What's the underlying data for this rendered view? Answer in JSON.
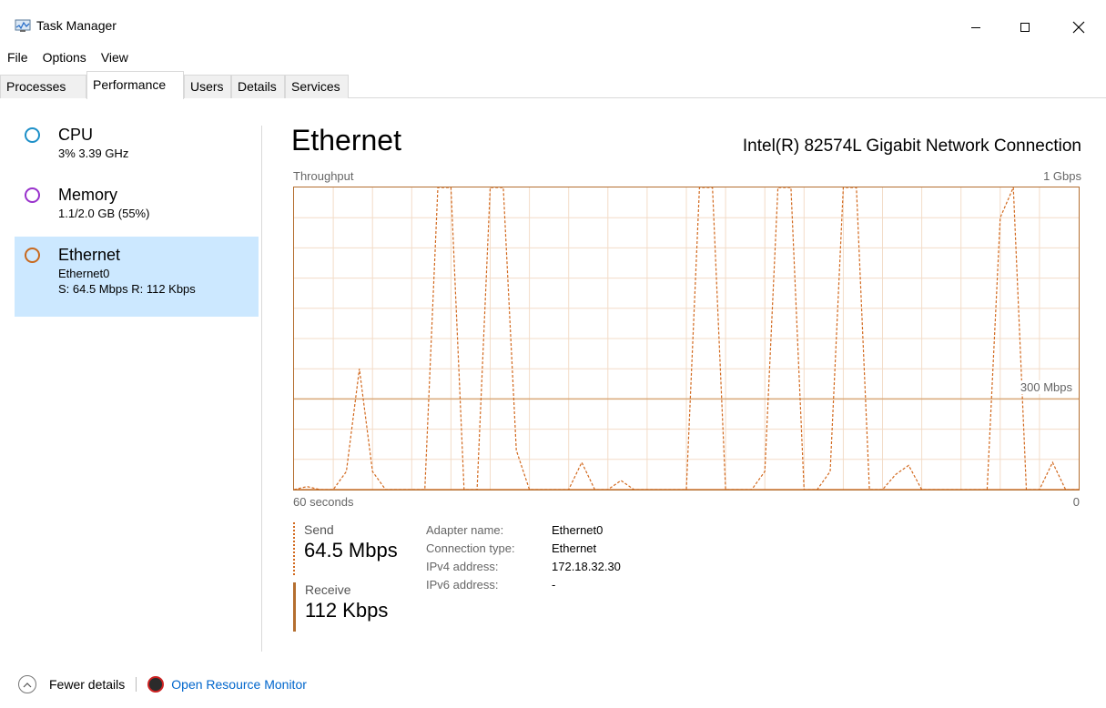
{
  "window": {
    "title": "Task Manager",
    "minimize_icon": "minimize-icon",
    "maximize_icon": "maximize-icon",
    "close_icon": "close-icon"
  },
  "menu": [
    "File",
    "Options",
    "View"
  ],
  "tabs": [
    "Processes",
    "Performance",
    "Users",
    "Details",
    "Services"
  ],
  "active_tab": "Performance",
  "sidebar": {
    "items": [
      {
        "title": "CPU",
        "line1": "3% 3.39 GHz",
        "line2": "",
        "color": "#1e90c8"
      },
      {
        "title": "Memory",
        "line1": "1.1/2.0 GB (55%)",
        "line2": "",
        "color": "#9932cc"
      },
      {
        "title": "Ethernet",
        "line1": "Ethernet0",
        "line2": "S: 64.5 Mbps R: 112 Kbps",
        "color": "#c8691e"
      }
    ],
    "selected": "Ethernet"
  },
  "main": {
    "title": "Ethernet",
    "adapter_full_name": "Intel(R) 82574L Gigabit Network Connection",
    "throughput_label": "Throughput",
    "max_label": "1 Gbps",
    "mid_label": "300 Mbps",
    "time_left": "60 seconds",
    "time_right": "0"
  },
  "stats": {
    "send_label": "Send",
    "send_value": "64.5 Mbps",
    "receive_label": "Receive",
    "receive_value": "112 Kbps"
  },
  "info": [
    {
      "label": "Adapter name:",
      "value": "Ethernet0"
    },
    {
      "label": "Connection type:",
      "value": "Ethernet"
    },
    {
      "label": "IPv4 address:",
      "value": "172.18.32.30"
    },
    {
      "label": "IPv6 address:",
      "value": "-"
    }
  ],
  "footer": {
    "fewer_details": "Fewer details",
    "open_monitor": "Open Resource Monitor"
  },
  "colors": {
    "graph_line": "#d2691e",
    "graph_border": "#b46e2f",
    "grid": "#f3dcc8",
    "accent_link": "#0066cc",
    "selected_bg": "#cce8ff"
  },
  "chart_data": {
    "type": "line",
    "title": "",
    "ylabel": "Throughput",
    "ylim": [
      0,
      1000
    ],
    "xlim": [
      60,
      0
    ],
    "y_ref": 300,
    "y_ref_label": "300 Mbps",
    "series": [
      {
        "name": "Send",
        "style": "dashed",
        "x": [
          60,
          59,
          58,
          57,
          56,
          55,
          54,
          53,
          52,
          51,
          50,
          49,
          48,
          47,
          46,
          45,
          44,
          43,
          42,
          41,
          40,
          39,
          38,
          37,
          36,
          35,
          34,
          33,
          32,
          31,
          30,
          29,
          28,
          27,
          26,
          25,
          24,
          23,
          22,
          21,
          20,
          19,
          18,
          17,
          16,
          15,
          14,
          13,
          12,
          11,
          10,
          9,
          8,
          7,
          6,
          5,
          4,
          3,
          2,
          1,
          0
        ],
        "values": [
          0,
          10,
          0,
          0,
          60,
          400,
          60,
          0,
          0,
          0,
          0,
          1000,
          1000,
          0,
          0,
          1000,
          1000,
          130,
          0,
          0,
          0,
          0,
          90,
          0,
          0,
          30,
          0,
          0,
          0,
          0,
          0,
          1000,
          1000,
          0,
          0,
          0,
          60,
          1000,
          1000,
          0,
          0,
          60,
          1000,
          1000,
          0,
          0,
          50,
          80,
          0,
          0,
          0,
          0,
          0,
          0,
          900,
          1000,
          0,
          0,
          90,
          0,
          0
        ]
      },
      {
        "name": "Receive",
        "style": "solid",
        "x": [
          60,
          0
        ],
        "values": [
          0,
          0
        ]
      }
    ]
  }
}
